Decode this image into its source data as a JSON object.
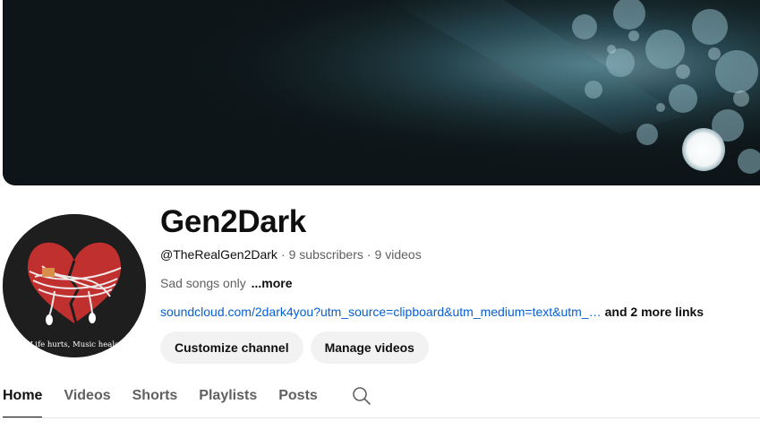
{
  "channel": {
    "name": "Gen2Dark",
    "handle": "@TheRealGen2Dark",
    "subscribers": "9 subscribers",
    "videos": "9 videos",
    "separator": "·",
    "description": "Sad songs only",
    "description_more": "...more",
    "link": "soundcloud.com/2dark4you?utm_source=clipboard&utm_medium=text&utm_…",
    "more_links": "and 2 more links",
    "avatar_caption": "Life hurts, Music heals"
  },
  "actions": {
    "customize_label": "Customize channel",
    "manage_label": "Manage videos"
  },
  "tabs": [
    {
      "label": "Home",
      "active": true
    },
    {
      "label": "Videos",
      "active": false
    },
    {
      "label": "Shorts",
      "active": false
    },
    {
      "label": "Playlists",
      "active": false
    },
    {
      "label": "Posts",
      "active": false
    }
  ],
  "icons": {
    "tab_search": "search-icon"
  },
  "colors": {
    "link": "#065fd4",
    "button_bg": "#f2f2f2",
    "heart": "#c0302e"
  }
}
